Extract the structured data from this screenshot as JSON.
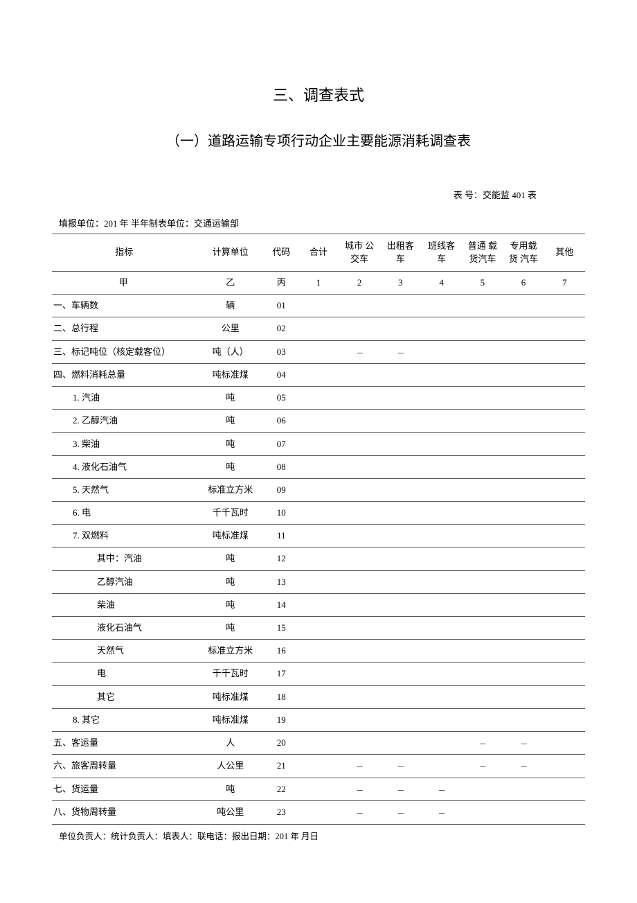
{
  "titles": {
    "main": "三、调查表式",
    "sub": "（一）道路运输专项行动企业主要能源消耗调查表"
  },
  "form_code": "表 号：交能监 401 表",
  "header_line": "填报单位：201 年 半年制表单位：交通运输部",
  "columns": {
    "indicator": "指标",
    "unit": "计算单位",
    "code": "代码",
    "c1": "合计",
    "c2": "城市 公交车",
    "c3": "出租客车",
    "c4": "班线客车",
    "c5": "普通 载货汽车",
    "c6": "专用载货 汽车",
    "c7": "其他"
  },
  "label_row": {
    "indicator": "甲",
    "unit": "乙",
    "code": "丙",
    "c1": "1",
    "c2": "2",
    "c3": "3",
    "c4": "4",
    "c5": "5",
    "c6": "6",
    "c7": "7"
  },
  "rows": [
    {
      "label": "一、车辆数",
      "unit": "辆",
      "code": "01",
      "indent": 0,
      "cells": [
        "",
        "",
        "",
        "",
        "",
        "",
        ""
      ]
    },
    {
      "label": "二、总行程",
      "unit": "公里",
      "code": "02",
      "indent": 0,
      "cells": [
        "",
        "",
        "",
        "",
        "",
        "",
        ""
      ]
    },
    {
      "label": "三、标记吨位（核定载客位）",
      "unit": "吨（人）",
      "code": "03",
      "indent": 0,
      "cells": [
        "",
        "---",
        "---",
        "",
        "",
        "",
        ""
      ]
    },
    {
      "label": "四、燃料消耗总量",
      "unit": "吨标准煤",
      "code": "04",
      "indent": 0,
      "cells": [
        "",
        "",
        "",
        "",
        "",
        "",
        ""
      ]
    },
    {
      "label": "1. 汽油",
      "unit": "吨",
      "code": "05",
      "indent": 1,
      "cells": [
        "",
        "",
        "",
        "",
        "",
        "",
        ""
      ]
    },
    {
      "label": "2. 乙醇汽油",
      "unit": "吨",
      "code": "06",
      "indent": 1,
      "cells": [
        "",
        "",
        "",
        "",
        "",
        "",
        ""
      ]
    },
    {
      "label": "3. 柴油",
      "unit": "吨",
      "code": "07",
      "indent": 1,
      "cells": [
        "",
        "",
        "",
        "",
        "",
        "",
        ""
      ]
    },
    {
      "label": "4. 液化石油气",
      "unit": "吨",
      "code": "08",
      "indent": 1,
      "cells": [
        "",
        "",
        "",
        "",
        "",
        "",
        ""
      ]
    },
    {
      "label": "5. 天然气",
      "unit": "标准立方米",
      "code": "09",
      "indent": 1,
      "cells": [
        "",
        "",
        "",
        "",
        "",
        "",
        ""
      ]
    },
    {
      "label": "6. 电",
      "unit": "千千瓦时",
      "code": "10",
      "indent": 1,
      "cells": [
        "",
        "",
        "",
        "",
        "",
        "",
        ""
      ]
    },
    {
      "label": "7. 双燃料",
      "unit": "吨标准煤",
      "code": "11",
      "indent": 1,
      "cells": [
        "",
        "",
        "",
        "",
        "",
        "",
        ""
      ]
    },
    {
      "label": "其中：汽油",
      "unit": "吨",
      "code": "12",
      "indent": 2,
      "cells": [
        "",
        "",
        "",
        "",
        "",
        "",
        ""
      ]
    },
    {
      "label": "乙醇汽油",
      "unit": "吨",
      "code": "13",
      "indent": 2,
      "cells": [
        "",
        "",
        "",
        "",
        "",
        "",
        ""
      ]
    },
    {
      "label": "柴油",
      "unit": "吨",
      "code": "14",
      "indent": 2,
      "cells": [
        "",
        "",
        "",
        "",
        "",
        "",
        ""
      ]
    },
    {
      "label": "液化石油气",
      "unit": "吨",
      "code": "15",
      "indent": 2,
      "cells": [
        "",
        "",
        "",
        "",
        "",
        "",
        ""
      ]
    },
    {
      "label": "天然气",
      "unit": "标准立方米",
      "code": "16",
      "indent": 2,
      "cells": [
        "",
        "",
        "",
        "",
        "",
        "",
        ""
      ]
    },
    {
      "label": "电",
      "unit": "千千瓦时",
      "code": "17",
      "indent": 2,
      "cells": [
        "",
        "",
        "",
        "",
        "",
        "",
        ""
      ]
    },
    {
      "label": "其它",
      "unit": "吨标准煤",
      "code": "18",
      "indent": 2,
      "cells": [
        "",
        "",
        "",
        "",
        "",
        "",
        ""
      ]
    },
    {
      "label": "8. 其它",
      "unit": "吨标准煤",
      "code": "19",
      "indent": 1,
      "cells": [
        "",
        "",
        "",
        "",
        "",
        "",
        ""
      ]
    },
    {
      "label": "五、客运量",
      "unit": "人",
      "code": "20",
      "indent": 0,
      "cells": [
        "",
        "",
        "",
        "",
        "---",
        "---",
        ""
      ]
    },
    {
      "label": "六、旅客周转量",
      "unit": "人公里",
      "code": "21",
      "indent": 0,
      "cells": [
        "",
        "---",
        "---",
        "",
        "---",
        "---",
        ""
      ]
    },
    {
      "label": "七、货运量",
      "unit": "吨",
      "code": "22",
      "indent": 0,
      "cells": [
        "",
        "---",
        "---",
        "---",
        "",
        "",
        ""
      ]
    },
    {
      "label": "八、货物周转量",
      "unit": "吨公里",
      "code": "23",
      "indent": 0,
      "cells": [
        "",
        "---",
        "---",
        "---",
        "",
        "",
        ""
      ]
    }
  ],
  "footer": "单位负责人：统计负责人：填表人：联电话：报出日期：201 年 月日"
}
